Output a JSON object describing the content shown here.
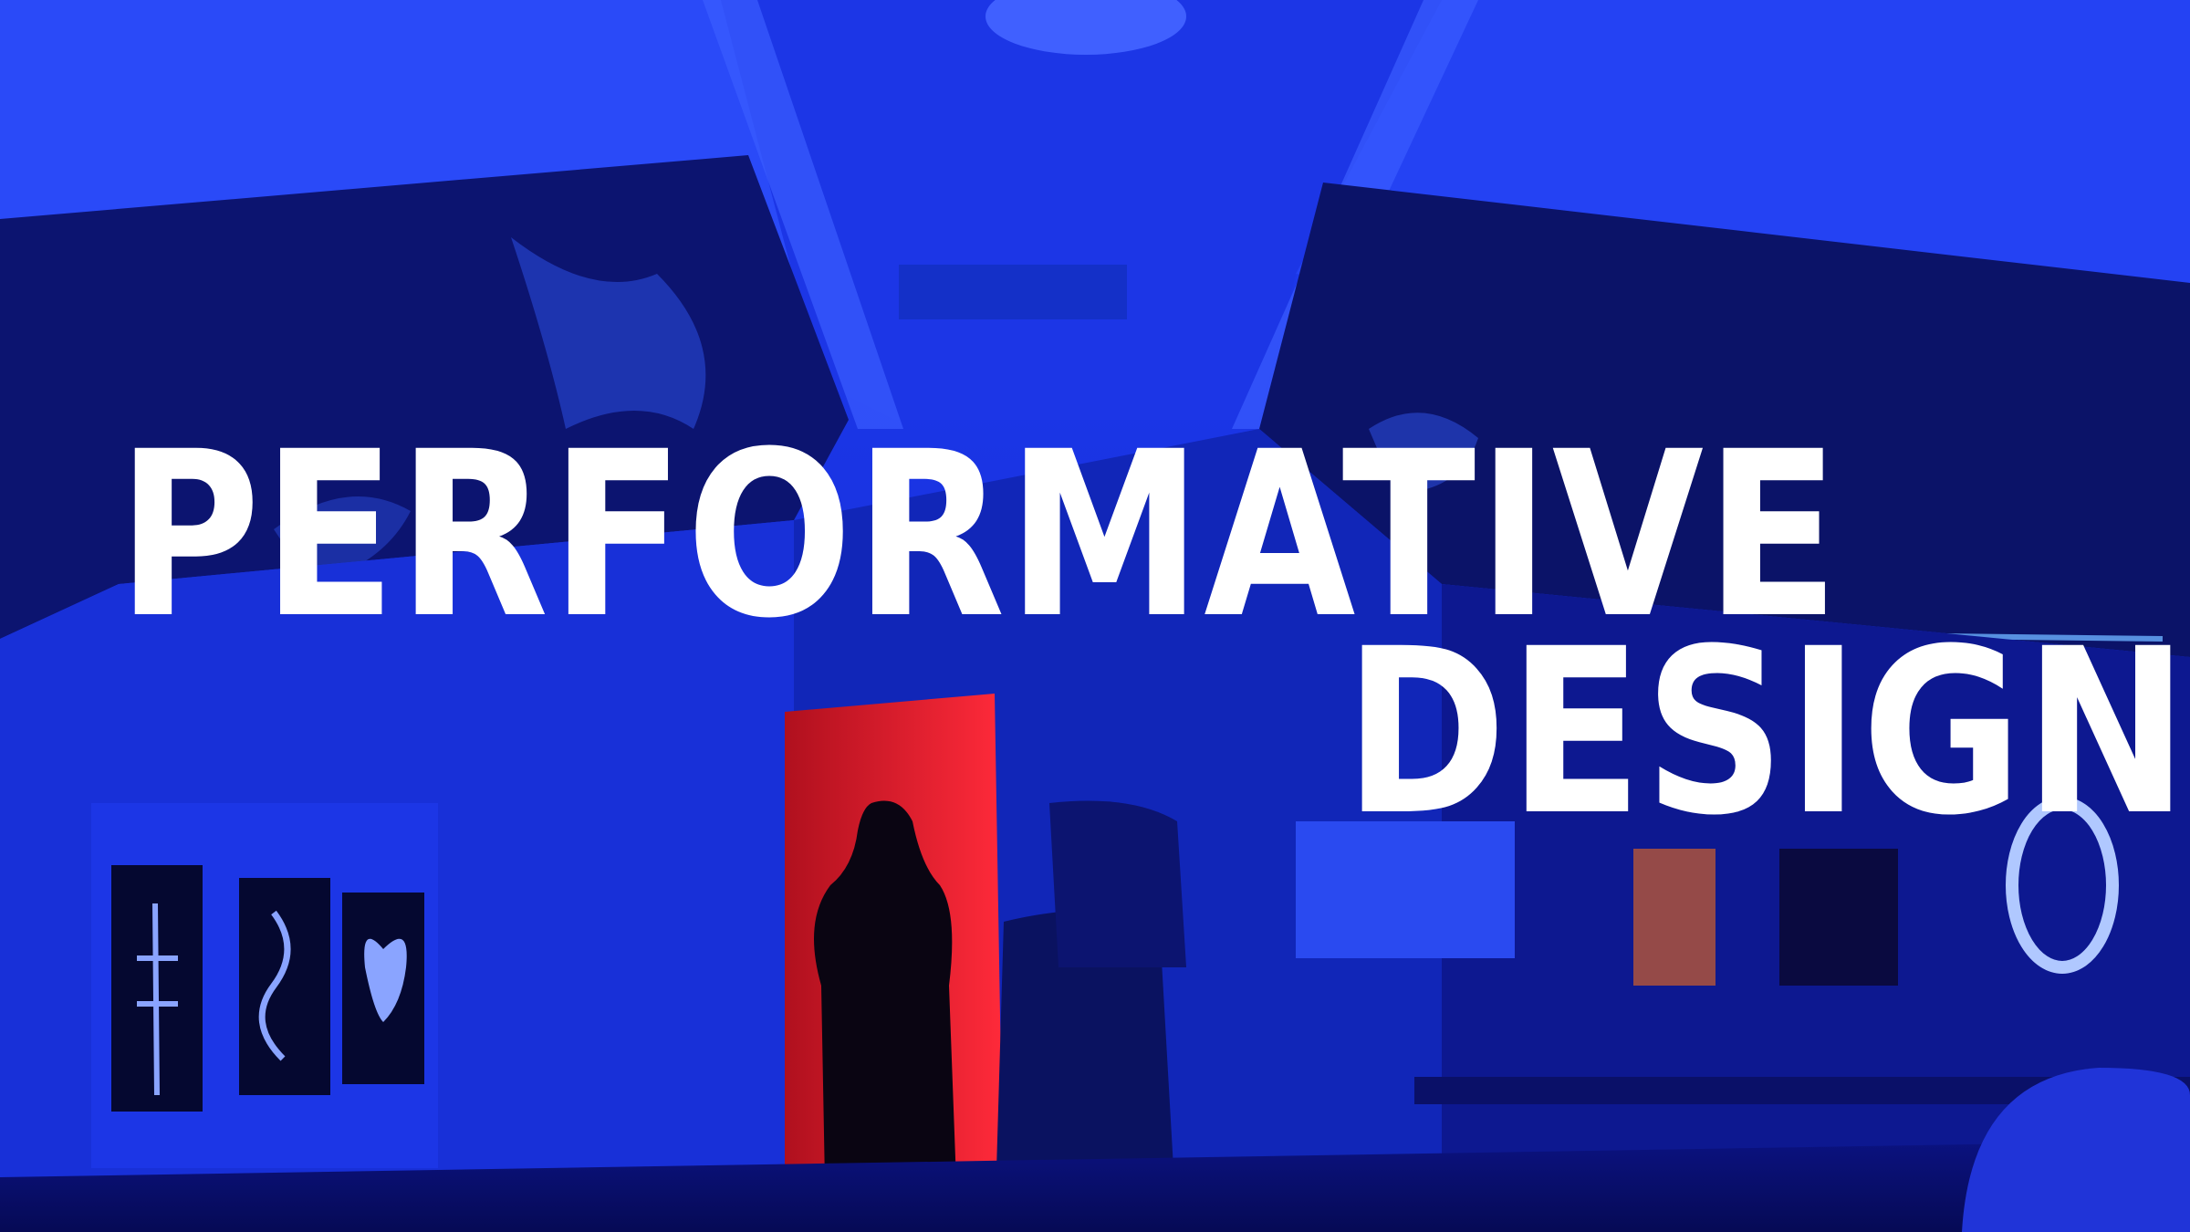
{
  "headline": {
    "line1": "PERFORMATIVE",
    "line2": "DESIGN"
  },
  "palette": {
    "dominant_blue": "#1a2ee0",
    "deep_blue": "#0b1280",
    "door_red": "#e0202a",
    "text": "#ffffff"
  }
}
